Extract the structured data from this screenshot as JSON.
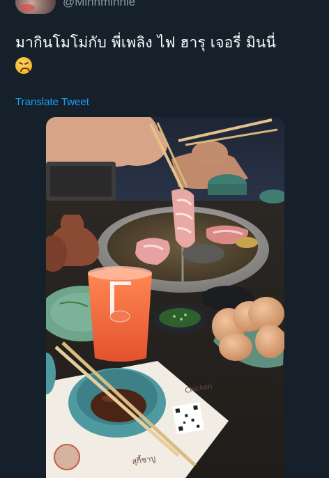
{
  "tweet": {
    "handle": "@Minhminnie",
    "text": "มากินโมโม่กับ พี่เพลิง ไฟ ฮารุ เจอรี่ มินนี่",
    "emoji_icon": "persevering-face-icon",
    "translate_label": "Translate Tweet"
  },
  "photo": {
    "menu_text_1": "สุกี้ชาบู",
    "menu_text_2": "Chicken"
  },
  "colors": {
    "background": "#15202b",
    "text": "#ffffff",
    "muted": "#8899a6",
    "link": "#1da1f2"
  }
}
